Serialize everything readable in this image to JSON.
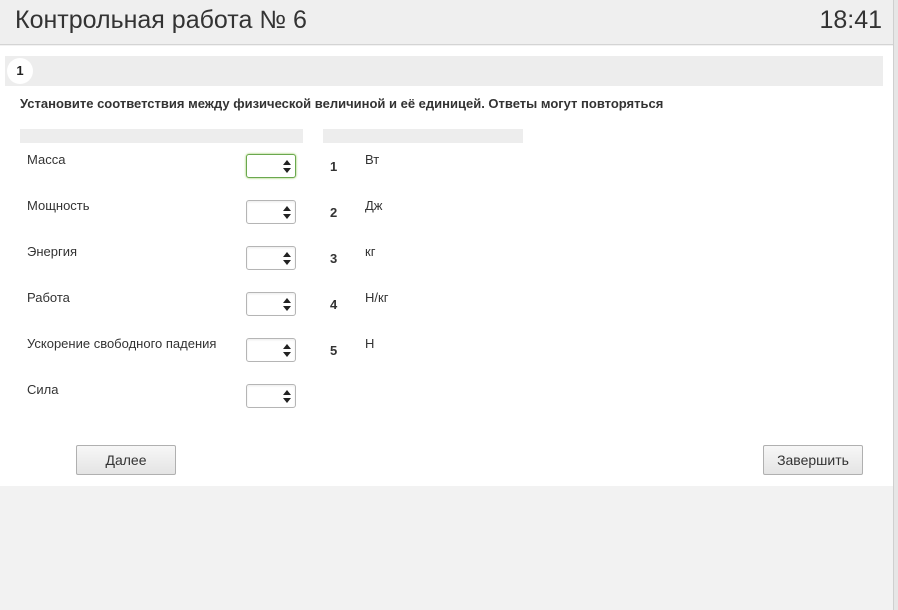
{
  "header": {
    "title": "Контрольная работа № 6",
    "time": "18:41"
  },
  "question": {
    "number": "1",
    "text": "Установите соответствия между физической величиной и её единицей. Ответы могут повторяться"
  },
  "left_items": [
    {
      "label": "Масса",
      "selected": ""
    },
    {
      "label": "Мощность",
      "selected": ""
    },
    {
      "label": "Энергия",
      "selected": ""
    },
    {
      "label": "Работа",
      "selected": ""
    },
    {
      "label": "Ускорение свободного падения",
      "selected": ""
    },
    {
      "label": "Сила",
      "selected": ""
    }
  ],
  "right_items": [
    {
      "num": "1",
      "unit": "Вт"
    },
    {
      "num": "2",
      "unit": "Дж"
    },
    {
      "num": "3",
      "unit": "кг"
    },
    {
      "num": "4",
      "unit": "Н/кг"
    },
    {
      "num": "5",
      "unit": "Н"
    }
  ],
  "buttons": {
    "next": "Далее",
    "finish": "Завершить"
  },
  "colors": {
    "focus_border": "#6aa84f",
    "panel_bg": "#ffffff",
    "page_bg": "#f2f2f2"
  }
}
